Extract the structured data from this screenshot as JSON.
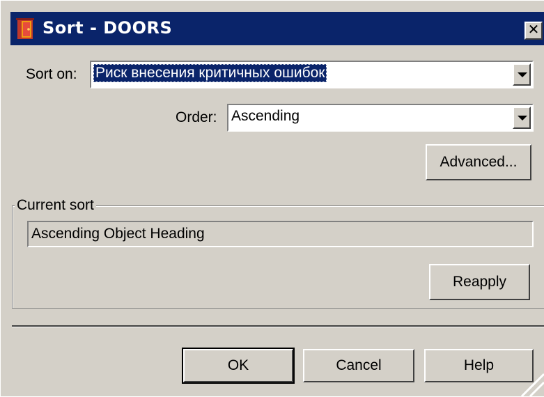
{
  "window": {
    "title": "Sort - DOORS",
    "app_icon": "doors-app-icon",
    "close_icon": "close-icon",
    "close_glyph": "✕"
  },
  "sort_on": {
    "label": "Sort on:",
    "value": "Риск внесения критичных ошибок"
  },
  "order": {
    "label": "Order:",
    "value": "Ascending"
  },
  "advanced_button": "Advanced...",
  "current_sort": {
    "group_label": "Current sort",
    "value": "Ascending Object Heading",
    "reapply_button": "Reapply"
  },
  "footer": {
    "ok": "OK",
    "cancel": "Cancel",
    "help": "Help"
  },
  "colors": {
    "titlebar": "#0a246a",
    "face": "#d4d0c8",
    "selection": "#0a246a"
  }
}
